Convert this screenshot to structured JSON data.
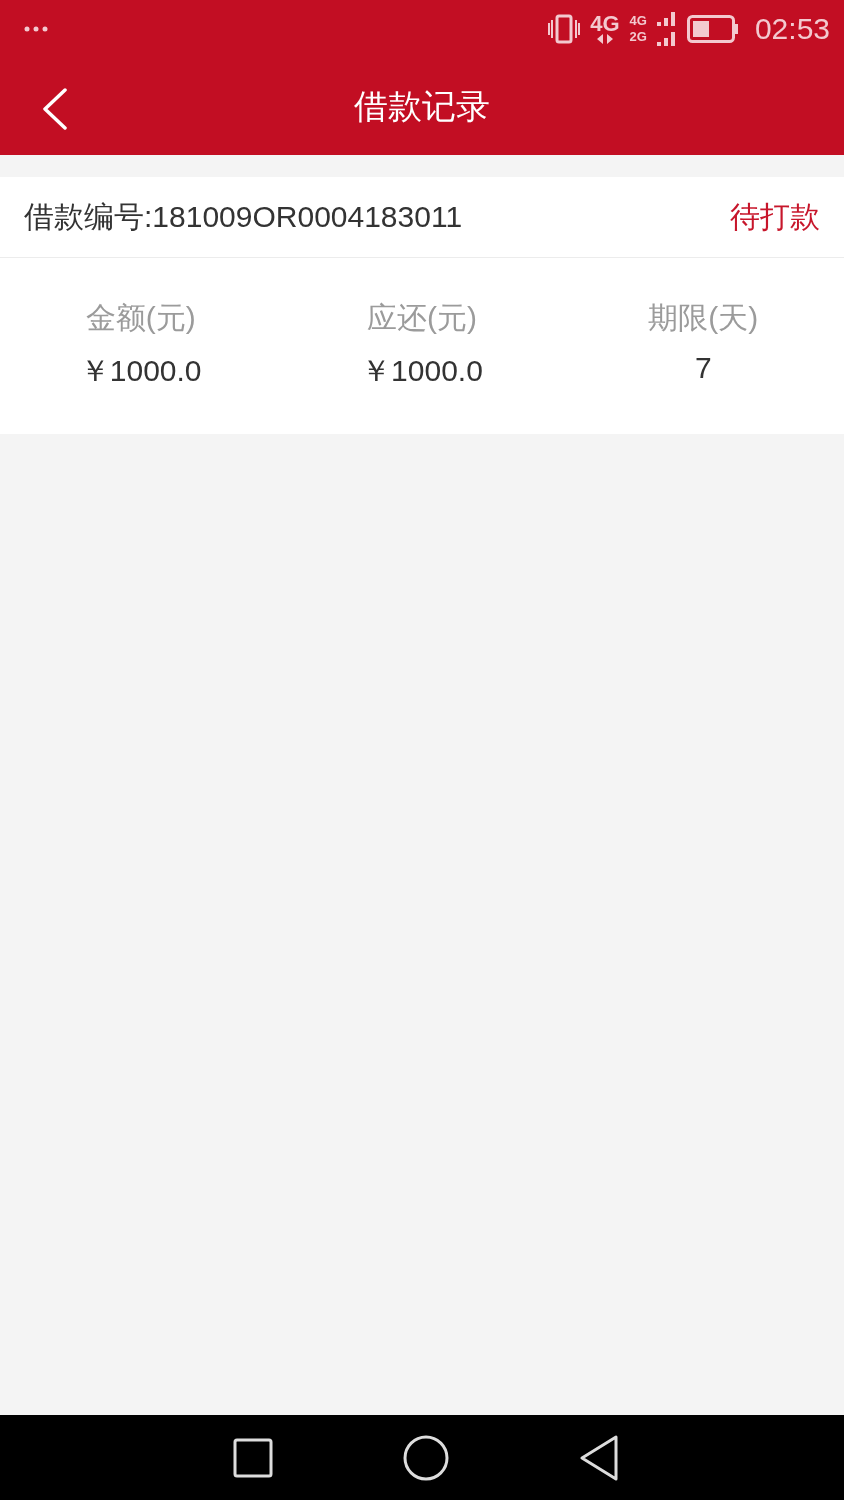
{
  "status_bar": {
    "network_labels": [
      "4G",
      "4G",
      "2G"
    ],
    "time": "02:53"
  },
  "header": {
    "title": "借款记录"
  },
  "loan": {
    "number": "借款编号:181009OR0004183011",
    "status": "待打款",
    "fields": [
      {
        "label": "金额(元)",
        "value": "￥1000.0"
      },
      {
        "label": "应还(元)",
        "value": "￥1000.0"
      },
      {
        "label": "期限(天)",
        "value": "7"
      }
    ]
  }
}
